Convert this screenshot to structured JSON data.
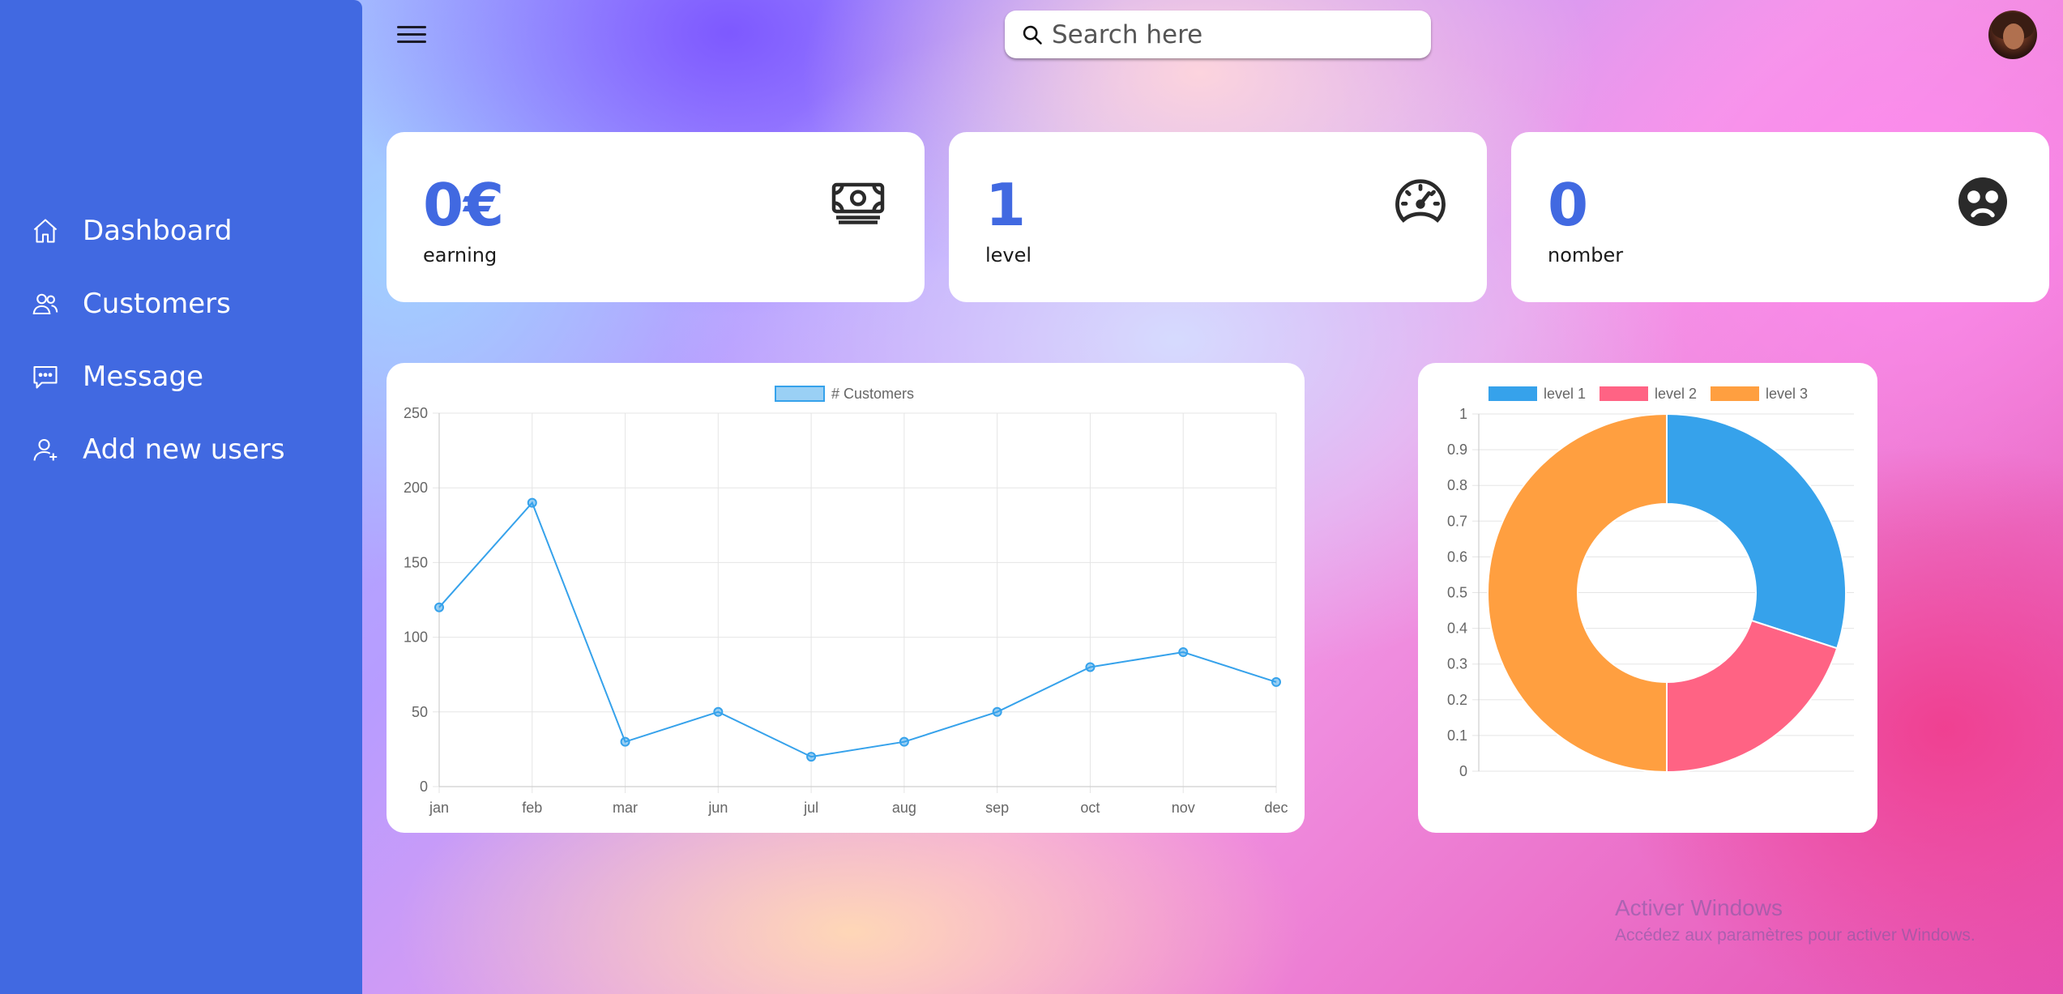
{
  "sidebar": {
    "items": [
      {
        "label": "Dashboard",
        "icon": "home-icon"
      },
      {
        "label": "Customers",
        "icon": "users-icon"
      },
      {
        "label": "Message",
        "icon": "message-icon"
      },
      {
        "label": "Add new users",
        "icon": "add-user-icon"
      }
    ]
  },
  "topbar": {
    "menu_icon": "hamburger-menu-icon",
    "search": {
      "placeholder": "Search here",
      "icon": "search-icon"
    },
    "avatar_icon": "user-avatar"
  },
  "cards": [
    {
      "value": "0€",
      "label": "earning",
      "icon": "money-icon"
    },
    {
      "value": "1",
      "label": "level",
      "icon": "speedometer-icon"
    },
    {
      "value": "0",
      "label": "nomber",
      "icon": "sad-face-icon"
    }
  ],
  "colors": {
    "sidebar": "#4169e1",
    "accent": "#4169e1",
    "line": "#36a2eb",
    "level1": "#36a2eb",
    "level2": "#ff6384",
    "level3": "#ff9f40"
  },
  "chart_data": [
    {
      "type": "line",
      "legend": [
        "# Customers"
      ],
      "categories": [
        "jan",
        "feb",
        "mar",
        "jun",
        "jul",
        "aug",
        "sep",
        "oct",
        "nov",
        "dec"
      ],
      "series": [
        {
          "name": "# Customers",
          "values": [
            120,
            190,
            30,
            50,
            20,
            30,
            50,
            80,
            90,
            70
          ]
        }
      ],
      "ylim": [
        0,
        250
      ],
      "yticks": [
        "0",
        "50",
        "100",
        "150",
        "200",
        "250"
      ],
      "grid": true,
      "legend_position": "top"
    },
    {
      "type": "pie",
      "donut": true,
      "labels": [
        "level 1",
        "level 2",
        "level 3"
      ],
      "values": [
        30,
        20,
        50
      ],
      "yticks": [
        "0",
        "0.1",
        "0.2",
        "0.3",
        "0.4",
        "0.5",
        "0.6",
        "0.7",
        "0.8",
        "0.9",
        "1"
      ],
      "grid": true,
      "legend_position": "top"
    }
  ],
  "watermark": {
    "title": "Activer Windows",
    "subtitle": "Accédez aux paramètres pour activer Windows."
  }
}
